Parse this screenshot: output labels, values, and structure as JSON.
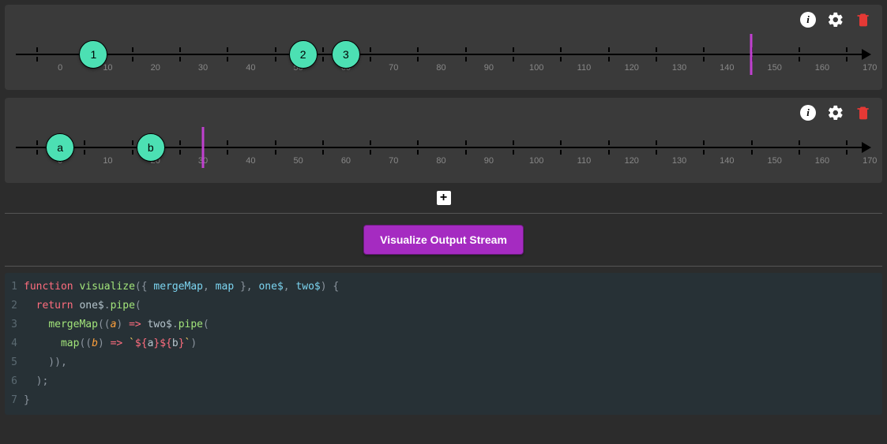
{
  "timelines": [
    {
      "ticks": [
        0,
        10,
        20,
        30,
        40,
        50,
        60,
        70,
        80,
        90,
        100,
        110,
        120,
        130,
        140,
        150,
        160,
        170
      ],
      "marbles": [
        {
          "t": 12,
          "label": "1"
        },
        {
          "t": 56,
          "label": "2"
        },
        {
          "t": 65,
          "label": "3"
        }
      ],
      "complete": 150
    },
    {
      "ticks": [
        0,
        10,
        20,
        30,
        40,
        50,
        60,
        70,
        80,
        90,
        100,
        110,
        120,
        130,
        140,
        150,
        160,
        170
      ],
      "marbles": [
        {
          "t": 5,
          "label": "a"
        },
        {
          "t": 24,
          "label": "b"
        }
      ],
      "complete": 35
    }
  ],
  "icons": {
    "info": "i",
    "add": "+"
  },
  "button": {
    "visualize": "Visualize Output Stream"
  },
  "code": {
    "lines": [
      {
        "n": "1",
        "tokens": [
          [
            "kw",
            "function "
          ],
          [
            "fn",
            "visualize"
          ],
          [
            "punc",
            "({ "
          ],
          [
            "arg",
            "mergeMap"
          ],
          [
            "punc",
            ", "
          ],
          [
            "arg",
            "map"
          ],
          [
            "punc",
            " }, "
          ],
          [
            "arg",
            "one$"
          ],
          [
            "punc",
            ", "
          ],
          [
            "arg",
            "two$"
          ],
          [
            "punc",
            ") {"
          ]
        ]
      },
      {
        "n": "2",
        "tokens": [
          [
            "punc",
            "  "
          ],
          [
            "kw",
            "return "
          ],
          [
            "var",
            "one$"
          ],
          [
            "punc",
            "."
          ],
          [
            "fn",
            "pipe"
          ],
          [
            "punc",
            "("
          ]
        ]
      },
      {
        "n": "3",
        "tokens": [
          [
            "punc",
            "    "
          ],
          [
            "fn",
            "mergeMap"
          ],
          [
            "punc",
            "(("
          ],
          [
            "param",
            "a"
          ],
          [
            "punc",
            ") "
          ],
          [
            "kw",
            "=>"
          ],
          [
            "punc",
            " "
          ],
          [
            "var",
            "two$"
          ],
          [
            "punc",
            "."
          ],
          [
            "fn",
            "pipe"
          ],
          [
            "punc",
            "("
          ]
        ]
      },
      {
        "n": "4",
        "tokens": [
          [
            "punc",
            "      "
          ],
          [
            "fn",
            "map"
          ],
          [
            "punc",
            "(("
          ],
          [
            "param",
            "b"
          ],
          [
            "punc",
            ") "
          ],
          [
            "kw",
            "=>"
          ],
          [
            "punc",
            " "
          ],
          [
            "str",
            "`"
          ],
          [
            "interp-d",
            "${"
          ],
          [
            "interp-v",
            "a"
          ],
          [
            "interp-d",
            "}"
          ],
          [
            "interp-d",
            "${"
          ],
          [
            "interp-v",
            "b"
          ],
          [
            "interp-d",
            "}"
          ],
          [
            "str",
            "`"
          ],
          [
            "punc",
            ")"
          ]
        ]
      },
      {
        "n": "5",
        "tokens": [
          [
            "punc",
            "    )),"
          ]
        ]
      },
      {
        "n": "6",
        "tokens": [
          [
            "punc",
            "  );"
          ]
        ]
      },
      {
        "n": "7",
        "tokens": [
          [
            "punc",
            "}"
          ]
        ]
      }
    ]
  },
  "geometry": {
    "axisStart": 26,
    "axisEnd": 1058,
    "tickSpacing": 60.3
  }
}
